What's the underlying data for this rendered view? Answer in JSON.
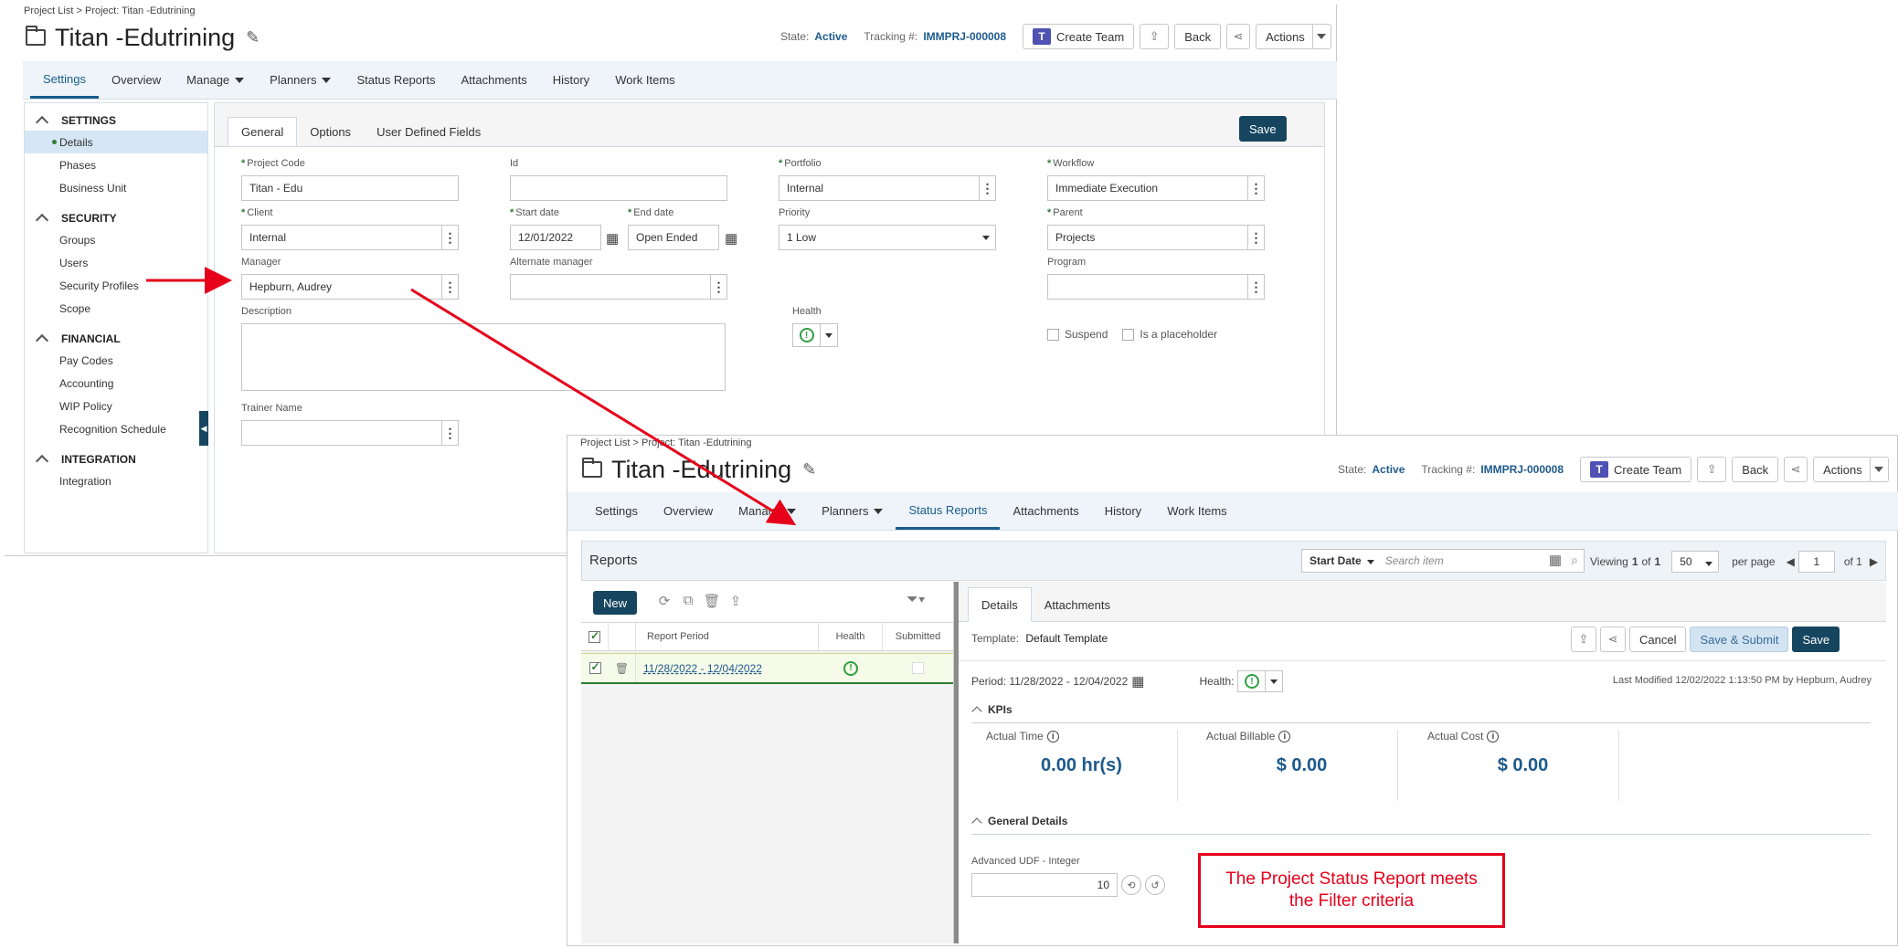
{
  "breadcrumb": {
    "list": "Project List",
    "sep": ">",
    "project1": "Project: Titan -Edutrining",
    "project2": "Project: Titan -Edutrining"
  },
  "title": "Titan -Edutrining",
  "header": {
    "state_label": "State:",
    "state_value": "Active",
    "tracking_label": "Tracking #:",
    "tracking_value": "IMMPRJ-000008",
    "create_team": "Create Team",
    "back": "Back",
    "actions": "Actions"
  },
  "nav": {
    "settings": "Settings",
    "overview": "Overview",
    "manage": "Manage",
    "planners": "Planners",
    "status_reports": "Status Reports",
    "attachments": "Attachments",
    "history": "History",
    "work_items": "Work Items"
  },
  "sidebar": {
    "settings": "SETTINGS",
    "details": "Details",
    "phases": "Phases",
    "business_unit": "Business Unit",
    "security": "SECURITY",
    "groups": "Groups",
    "users": "Users",
    "security_profiles": "Security Profiles",
    "scope": "Scope",
    "financial": "FINANCIAL",
    "pay_codes": "Pay Codes",
    "accounting": "Accounting",
    "wip_policy": "WIP Policy",
    "recognition_schedule": "Recognition Schedule",
    "integration": "INTEGRATION",
    "integration_item": "Integration"
  },
  "subtabs": {
    "general": "General",
    "options": "Options",
    "udf": "User Defined Fields",
    "save": "Save"
  },
  "form": {
    "project_code_label": "Project Code",
    "project_code": "Titan - Edu",
    "id_label": "Id",
    "id_value": "",
    "portfolio_label": "Portfolio",
    "portfolio": "Internal",
    "workflow_label": "Workflow",
    "workflow": "Immediate Execution",
    "client_label": "Client",
    "client": "Internal",
    "start_label": "Start date",
    "start": "12/01/2022",
    "end_label": "End date",
    "end": "Open Ended",
    "priority_label": "Priority",
    "priority": "1 Low",
    "parent_label": "Parent",
    "parent": "Projects",
    "manager_label": "Manager",
    "manager": "Hepburn, Audrey",
    "alt_manager_label": "Alternate manager",
    "alt_manager": "",
    "program_label": "Program",
    "program": "",
    "description_label": "Description",
    "health_label": "Health",
    "suspend": "Suspend",
    "placeholder": "Is a placeholder",
    "trainer_label": "Trainer Name",
    "trainer": ""
  },
  "reports": {
    "title": "Reports",
    "sort": "Start Date",
    "search_placeholder": "Search item",
    "viewing": "Viewing",
    "page_cur": "1",
    "of": "of",
    "page_total": "1",
    "per_page_value": "50",
    "per_page": "per page",
    "page_input": "1",
    "of_pages": "of 1",
    "new": "New",
    "col_period": "Report Period",
    "col_health": "Health",
    "col_submitted": "Submitted",
    "row_period": "11/28/2022 - 12/04/2022"
  },
  "details": {
    "tab_details": "Details",
    "tab_attachments": "Attachments",
    "template_label": "Template:",
    "template": "Default Template",
    "cancel": "Cancel",
    "save_submit": "Save & Submit",
    "save": "Save",
    "period": "Period: 11/28/2022 - 12/04/2022",
    "health_label": "Health:",
    "last_modified": "Last Modified 12/02/2022 1:13:50 PM by Hepburn, Audrey",
    "kpis": "KPIs",
    "actual_time_label": "Actual Time",
    "actual_time": "0.00 hr(s)",
    "actual_billable_label": "Actual Billable",
    "actual_billable": "$ 0.00",
    "actual_cost_label": "Actual Cost",
    "actual_cost": "$ 0.00",
    "general_details": "General Details",
    "udf_label": "Advanced UDF - Integer",
    "udf_value": "10"
  },
  "annotation": {
    "line1": "The Project Status Report meets",
    "line2": "the Filter criteria"
  },
  "colors": {
    "accent": "#1b5d8d",
    "dark_button": "#16455f",
    "health": "#2ea043",
    "annotation": "#e6001a"
  }
}
